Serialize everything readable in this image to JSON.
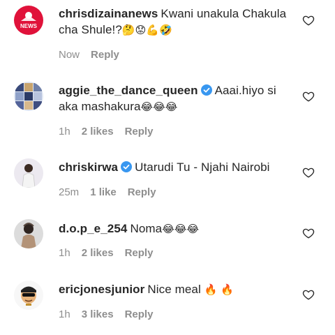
{
  "comments": [
    {
      "username": "chrisdizainanews",
      "verified": false,
      "text": "Kwani unakula Chakula cha Shule!?",
      "emoji": "🤔😟💪🤣",
      "time": "Now",
      "likes": "",
      "reply": "Reply",
      "avatar_icon": "news-logo-icon"
    },
    {
      "username": "aggie_the_dance_queen",
      "verified": true,
      "text": "Aaai.hiyo si aka mashakura",
      "emoji": "😂😂😂",
      "time": "1h",
      "likes": "2 likes",
      "reply": "Reply",
      "avatar_icon": "collage-avatar-icon"
    },
    {
      "username": "chriskirwa",
      "verified": true,
      "text": "Utarudi Tu - Njahi Nairobi",
      "emoji": "",
      "time": "25m",
      "likes": "1 like",
      "reply": "Reply",
      "avatar_icon": "person-avatar-icon"
    },
    {
      "username": "d.o.p_e_254",
      "verified": false,
      "text": "Noma",
      "emoji": "😂😂😂",
      "time": "1h",
      "likes": "2 likes",
      "reply": "Reply",
      "avatar_icon": "person-avatar-icon"
    },
    {
      "username": "ericjonesjunior",
      "verified": false,
      "text": "Nice meal",
      "emoji": "🔥 🔥",
      "time": "1h",
      "likes": "3 likes",
      "reply": "Reply",
      "avatar_icon": "cartoon-avatar-icon"
    }
  ],
  "colors": {
    "verified_blue": "#3897f0",
    "meta_gray": "#8e8e8e",
    "news_red": "#e0123a"
  }
}
